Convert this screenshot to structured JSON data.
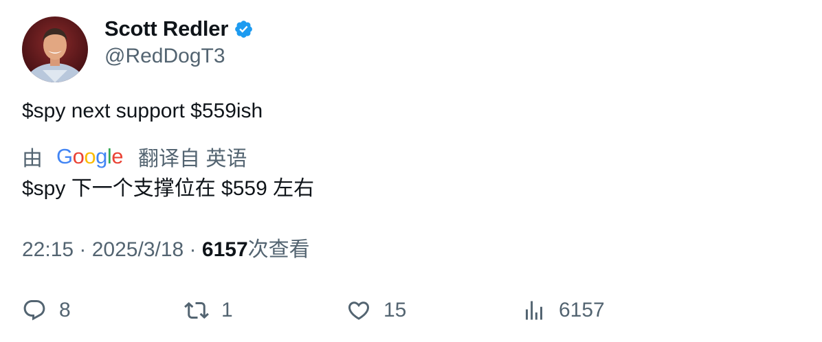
{
  "author": {
    "name": "Scott Redler",
    "handle": "@RedDogT3",
    "verified": true
  },
  "tweet": {
    "text": "$spy next support $559ish"
  },
  "translation": {
    "by_label": "由",
    "provider": "Google",
    "from_label": "翻译自 英语",
    "text": "$spy 下一个支撑位在 $559 左右"
  },
  "meta": {
    "time": "22:15",
    "separator": " · ",
    "date": "2025/3/18",
    "views": "6157",
    "views_label": "次查看"
  },
  "actions": {
    "replies": "8",
    "retweets": "1",
    "likes": "15",
    "views": "6157"
  },
  "colors": {
    "text_primary": "#0f1419",
    "text_secondary": "#536471",
    "verified_blue": "#1d9bf0"
  },
  "icons": {
    "verified": "verified-badge-icon",
    "reply": "reply-icon",
    "retweet": "retweet-icon",
    "like": "heart-icon",
    "views": "bar-chart-icon"
  }
}
